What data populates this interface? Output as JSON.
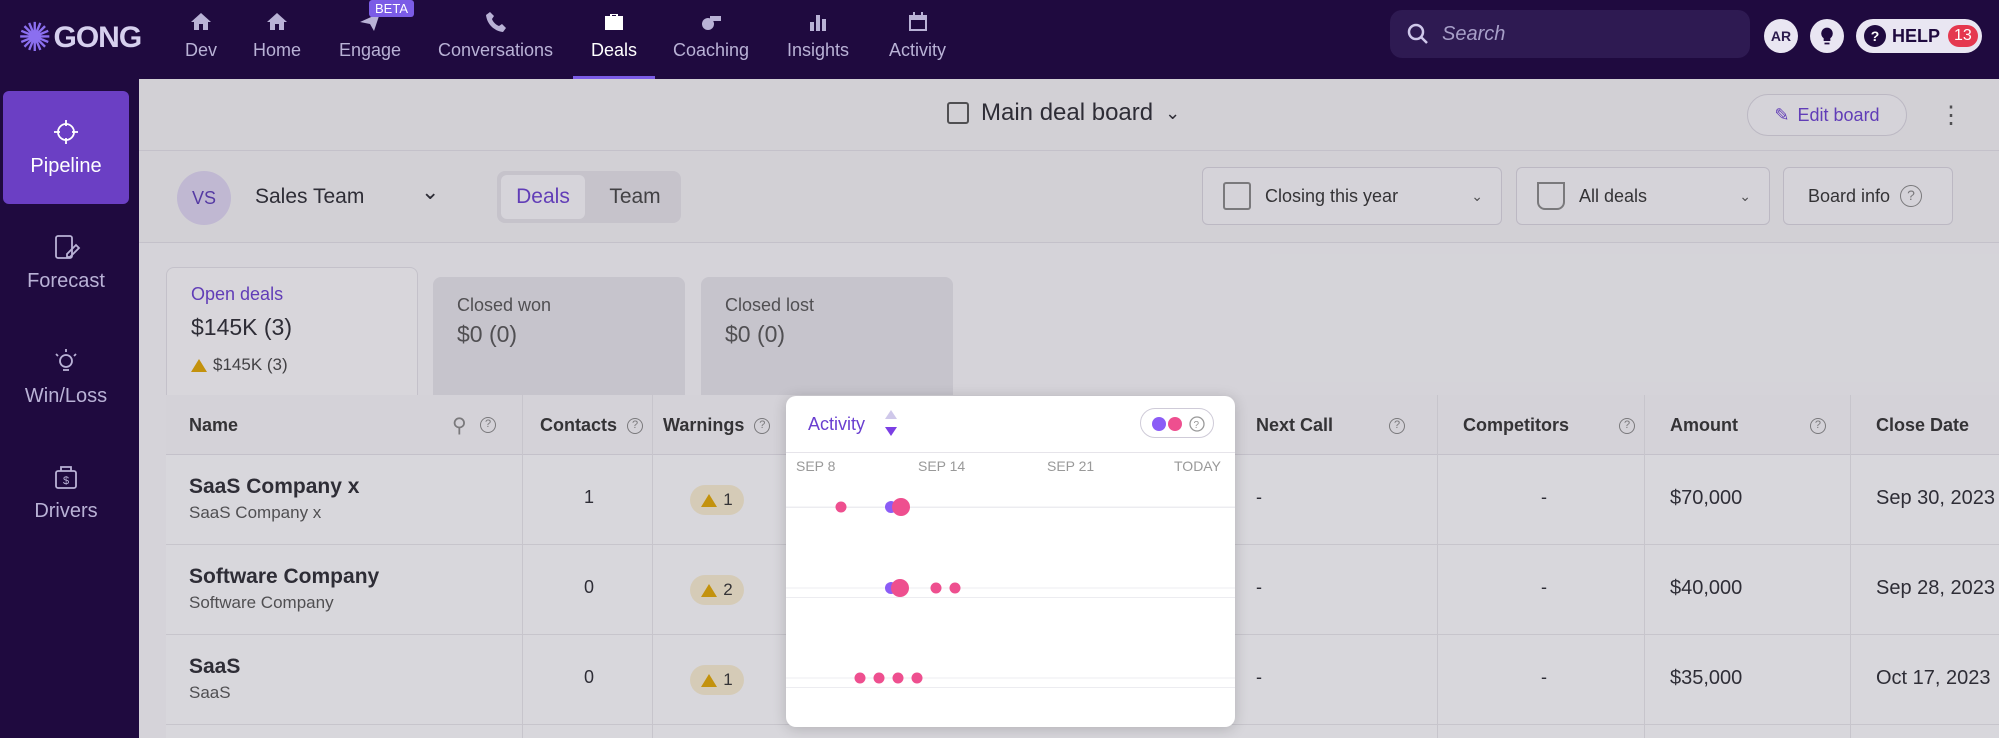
{
  "brand": {
    "logo_text": "GONG"
  },
  "topnav": {
    "items": [
      {
        "label": "Dev",
        "icon": "home-icon"
      },
      {
        "label": "Home",
        "icon": "home-icon"
      },
      {
        "label": "Engage",
        "icon": "paper-plane-icon",
        "badge": "BETA"
      },
      {
        "label": "Conversations",
        "icon": "phone-icon"
      },
      {
        "label": "Deals",
        "icon": "briefcase-icon",
        "active": true
      },
      {
        "label": "Coaching",
        "icon": "whistle-icon"
      },
      {
        "label": "Insights",
        "icon": "bar-chart-icon"
      },
      {
        "label": "Activity",
        "icon": "calendar-icon"
      }
    ],
    "search_placeholder": "Search",
    "avatar_initials": "AR",
    "help_label": "HELP",
    "help_count": "13"
  },
  "sidebar": {
    "items": [
      {
        "label": "Pipeline",
        "icon": "crosshair-icon",
        "active": true
      },
      {
        "label": "Forecast",
        "icon": "forecast-icon"
      },
      {
        "label": "Win/Loss",
        "icon": "lightbulb-icon"
      },
      {
        "label": "Drivers",
        "icon": "money-bag-icon"
      }
    ]
  },
  "board": {
    "title": "Main deal board",
    "edit_label": "Edit board"
  },
  "filters": {
    "team_initials": "VS",
    "team_name": "Sales Team",
    "segment_deals": "Deals",
    "segment_team": "Team",
    "closing": "Closing this year",
    "deals_filter": "All deals",
    "board_info": "Board info"
  },
  "summary": {
    "open": {
      "title": "Open deals",
      "value": "$145K (3)",
      "warning": "$145K (3)"
    },
    "won": {
      "title": "Closed won",
      "value": "$0 (0)"
    },
    "lost": {
      "title": "Closed lost",
      "value": "$0 (0)"
    }
  },
  "table": {
    "headers": {
      "name": "Name",
      "contacts": "Contacts",
      "warnings": "Warnings",
      "next_call": "Next Call",
      "competitors": "Competitors",
      "amount": "Amount",
      "close_date": "Close Date"
    },
    "rows": [
      {
        "name": "SaaS Company x",
        "sub": "SaaS Company x",
        "contacts": "1",
        "warnings": "1",
        "next_call": "-",
        "competitors": "-",
        "amount": "$70,000",
        "close_date": "Sep 30, 2023"
      },
      {
        "name": "Software Company",
        "sub": "Software Company",
        "contacts": "0",
        "warnings": "2",
        "next_call": "-",
        "competitors": "-",
        "amount": "$40,000",
        "close_date": "Sep 28, 2023"
      },
      {
        "name": "SaaS",
        "sub": "SaaS",
        "contacts": "0",
        "warnings": "1",
        "next_call": "-",
        "competitors": "-",
        "amount": "$35,000",
        "close_date": "Oct 17, 2023"
      }
    ]
  },
  "activity_popup": {
    "title": "Activity",
    "dates": [
      "SEP 8",
      "SEP 14",
      "SEP 21",
      "TODAY"
    ],
    "colors": {
      "purple": "#8b5cf6",
      "pink": "#ee4f8f"
    }
  }
}
